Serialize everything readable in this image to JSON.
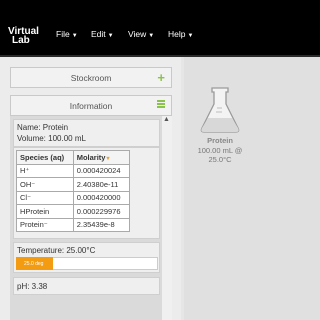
{
  "app": {
    "logo_line1": "Virtual",
    "logo_line2": "Lab"
  },
  "nav": [
    {
      "label": "File"
    },
    {
      "label": "Edit"
    },
    {
      "label": "View"
    },
    {
      "label": "Help"
    }
  ],
  "stockroom": {
    "title": "Stockroom"
  },
  "information": {
    "title": "Information",
    "name": "Name: Protein",
    "volume": "Volume: 100.00 mL",
    "table": {
      "headers": [
        "Species (aq)",
        "Molarity"
      ],
      "rows": [
        {
          "species": "H⁺",
          "molarity": "0.000420024"
        },
        {
          "species": "OH⁻",
          "molarity": "2.40380e-11"
        },
        {
          "species": "Cl⁻",
          "molarity": "0.000420000"
        },
        {
          "species": "HProtein",
          "molarity": "0.000229976"
        },
        {
          "species": "Protein⁻",
          "molarity": "2.35439e-8"
        }
      ]
    },
    "temperature": "Temperature: 25.00°C",
    "temp_slider": {
      "label": "25.0 deg",
      "fill_fraction": 0.26
    },
    "ph": "pH: 3.38"
  },
  "workbench": {
    "flask_name": "Protein",
    "flask_detail": "100.00 mL @ 25.0°C"
  },
  "colors": {
    "accent": "#8bc34a",
    "slider": "#f39c12"
  },
  "icons": {
    "stockroom_add": "plus-icon",
    "info_menu": "menu-icon",
    "flask": "erlenmeyer-flask-icon"
  }
}
